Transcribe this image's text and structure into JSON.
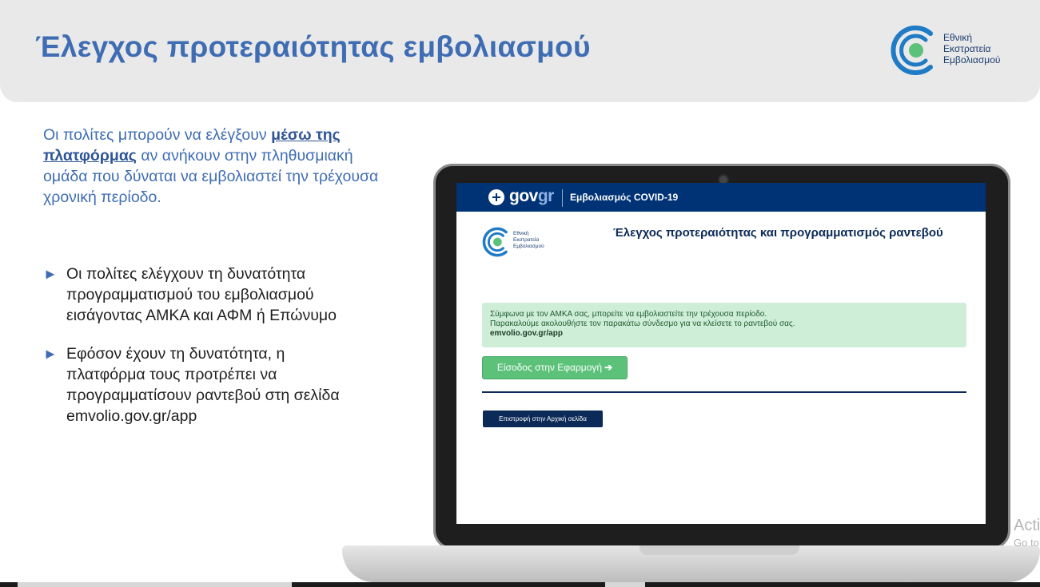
{
  "header": {
    "title": "Έλεγχος προτεραιότητας εμβολιασμού",
    "logo": {
      "line1": "Εθνική",
      "line2": "Εκστρατεία",
      "line3": "Εμβολιασμού"
    }
  },
  "intro": {
    "before_link": "Οι πολίτες μπορούν να ελέγξουν ",
    "link_text": "μέσω της πλατφόρμας",
    "after_link": " αν ανήκουν στην πληθυσμιακή ομάδα που δύναται να εμβολιαστεί την τρέχουσα χρονική περίοδο."
  },
  "bullets": [
    {
      "icon": "triangle-right-icon",
      "text": "Οι πολίτες ελέγχουν τη δυνατότητα προγραμματισμού του εμβολιασμού εισάγοντας ΑΜΚΑ και ΑΦΜ ή Επώνυμο"
    },
    {
      "icon": "triangle-right-icon",
      "text": "Εφόσον έχουν τη δυνατότητα, η πλατφόρμα τους προτρέπει να προγραμματίσουν ραντεβού στη σελίδα emvolio.gov.gr/app"
    }
  ],
  "screen": {
    "govbar": {
      "logo_main": "gov",
      "logo_accent": "gr",
      "service": "Εμβολιασμός COVID-19"
    },
    "inner_logo": {
      "line1": "Εθνική",
      "line2": "Εκστρατεία",
      "line3": "Εμβολιασμού"
    },
    "heading": "Έλεγχος προτεραιότητας και προγραμματισμός ραντεβού",
    "alert": {
      "line1": "Σύμφωνα με τον ΑΜΚΑ σας, μπορείτε να εμβολιαστείτε την τρέχουσα περίοδο.",
      "line2": "Παρακαλούμε ακολουθήστε τον παρακάτω σύνδεσμο για να κλείσετε το ραντεβού σας.",
      "link": "emvolio.gov.gr/app"
    },
    "app_button": "Είσοδος στην Εφαρμογή",
    "home_button": "Επιστροφή στην Αρχική σελίδα"
  },
  "watermark": {
    "line1": "Acti",
    "line2": "Go to"
  },
  "colors": {
    "title_blue": "#3f6db3",
    "gov_navy": "#003375",
    "success_bg": "#cfeed8",
    "button_green": "#5cc27a"
  }
}
